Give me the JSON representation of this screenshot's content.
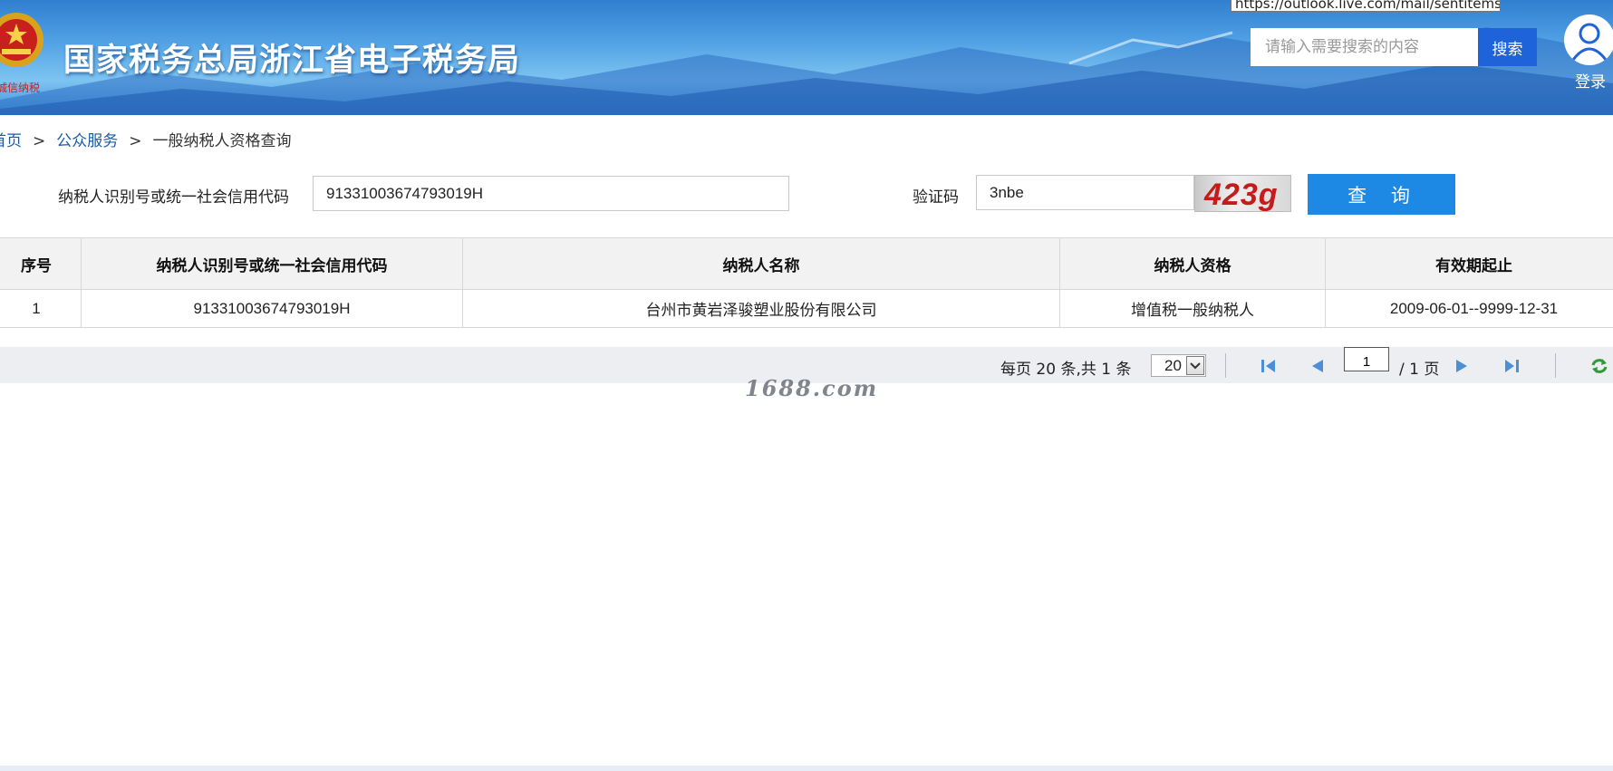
{
  "header": {
    "site_title": "国家税务总局浙江省电子税务局",
    "url_tooltip": "https://outlook.live.com/mail/sentitems",
    "search_placeholder": "请输入需要搜索的内容",
    "search_button": "搜索",
    "login_label": "登录"
  },
  "breadcrumb": {
    "home": "首页",
    "public_services": "公众服务",
    "current": "一般纳税人资格查询",
    "separator": ">"
  },
  "form": {
    "taxid_label": "纳税人识别号或统一社会信用代码",
    "taxid_value": "91331003674793019H",
    "captcha_label": "验证码",
    "captcha_value": "3nbe",
    "captcha_image_text": "423g",
    "query_button": "查 询"
  },
  "table": {
    "headers": [
      "序号",
      "纳税人识别号或统一社会信用代码",
      "纳税人名称",
      "纳税人资格",
      "有效期起止"
    ],
    "rows": [
      [
        "1",
        "91331003674793019H",
        "台州市黄岩泽骏塑业股份有限公司",
        "增值税一般纳税人",
        "2009-06-01--9999-12-31"
      ]
    ]
  },
  "pager": {
    "summary": "每页 20 条,共 1 条",
    "page_size": "20",
    "current_page": "1",
    "total_pages": "/ 1 页"
  },
  "watermark": "1688.com",
  "colors": {
    "search_button": "#1e63d9",
    "query_button": "#1e88e5",
    "link": "#1a5aa6",
    "captcha_text": "#c41b1b"
  }
}
